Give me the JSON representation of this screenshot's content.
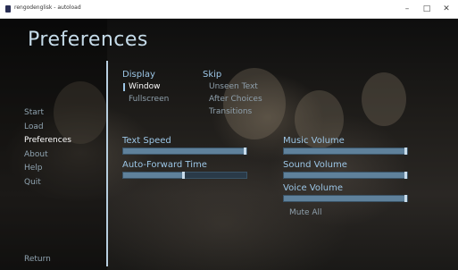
{
  "window": {
    "title": "rengodenglisk - autoload",
    "minimize_label": "–",
    "maximize_label": "□",
    "close_label": "✕"
  },
  "screen": {
    "title": "Preferences"
  },
  "nav": {
    "items": [
      {
        "label": "Start",
        "active": false
      },
      {
        "label": "Load",
        "active": false
      },
      {
        "label": "Preferences",
        "active": true
      },
      {
        "label": "About",
        "active": false
      },
      {
        "label": "Help",
        "active": false
      },
      {
        "label": "Quit",
        "active": false
      }
    ],
    "return_label": "Return"
  },
  "display": {
    "label": "Display",
    "options": [
      {
        "label": "Window",
        "selected": true
      },
      {
        "label": "Fullscreen",
        "selected": false
      }
    ]
  },
  "skip": {
    "label": "Skip",
    "options": [
      {
        "label": "Unseen Text",
        "selected": false
      },
      {
        "label": "After Choices",
        "selected": false
      },
      {
        "label": "Transitions",
        "selected": false
      }
    ]
  },
  "sliders": {
    "text_speed": {
      "label": "Text Speed",
      "value": 1.0
    },
    "auto_forward": {
      "label": "Auto-Forward Time",
      "value": 0.5
    },
    "music_volume": {
      "label": "Music Volume",
      "value": 1.0
    },
    "sound_volume": {
      "label": "Sound Volume",
      "value": 1.0
    },
    "voice_volume": {
      "label": "Voice Volume",
      "value": 1.0
    }
  },
  "mute_all": {
    "label": "Mute All"
  },
  "colors": {
    "accent": "#9cc6e6",
    "bar_fill": "#5f819b",
    "bar_track": "#2a3a48",
    "thumb": "#c9dceb"
  }
}
